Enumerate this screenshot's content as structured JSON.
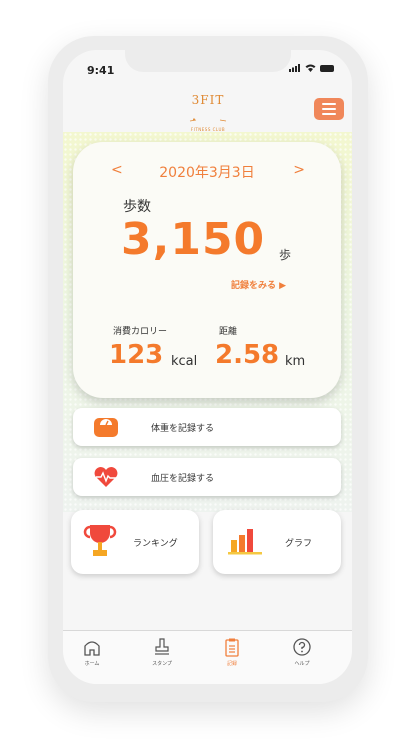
{
  "status": {
    "time": "9:41"
  },
  "header": {
    "brand": "3FIT",
    "brand_sub": "FITNESS CLUB"
  },
  "summary": {
    "prev": "<",
    "next": ">",
    "date": "2020年3月3日",
    "steps_label": "歩数",
    "steps_value": "3,150",
    "steps_unit": "歩",
    "record_link": "記録をみる ▶",
    "calories_label": "消費カロリー",
    "calories_value": "123",
    "calories_unit": "kcal",
    "distance_label": "距離",
    "distance_value": "2.58",
    "distance_unit": "km"
  },
  "actions": {
    "weight": "体重を記録する",
    "blood_pressure": "血圧を記録する",
    "ranking": "ランキング",
    "graph": "グラフ"
  },
  "tabs": [
    {
      "label": "ホーム",
      "icon": "home-icon"
    },
    {
      "label": "スタンプ",
      "icon": "stamp-icon"
    },
    {
      "label": "記録",
      "icon": "clipboard-icon",
      "active": true
    },
    {
      "label": "ヘルプ",
      "icon": "help-icon"
    }
  ],
  "colors": {
    "accent": "#f47a2c",
    "menu": "#f0875a",
    "card": "#fbfbf6"
  }
}
